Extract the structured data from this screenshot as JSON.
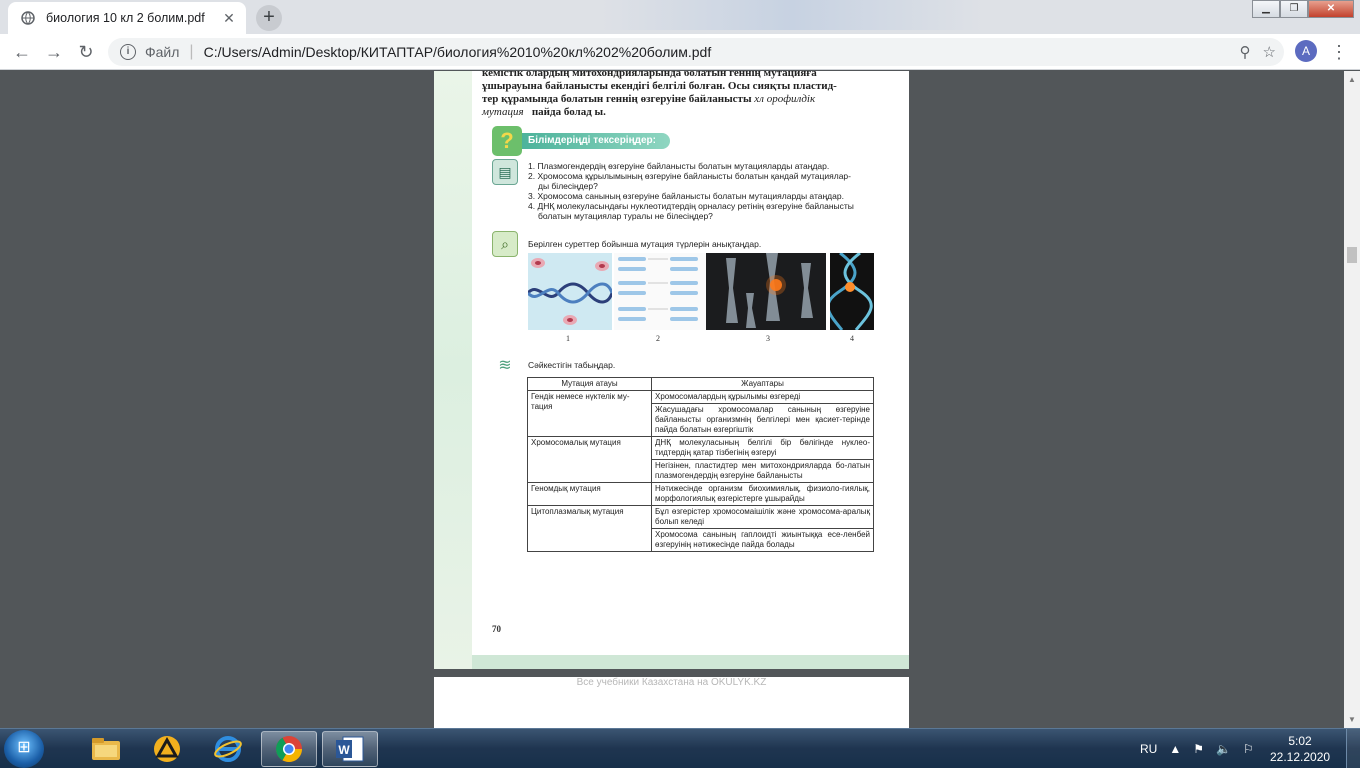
{
  "browser": {
    "tab_title": "биология 10 кл 2 болим.pdf",
    "close_glyph": "✕",
    "new_tab_glyph": "+",
    "omnibox_label": "Файл",
    "url": "C:/Users/Admin/Desktop/КИТАПТАР/биология%2010%20кл%202%20болим.pdf",
    "profile_initial": "A"
  },
  "page": {
    "intro_line1": "кемістік олардың митохондрияларында болатын геннің мутацияға",
    "intro_line2": "ұшырауына байланысты екендігі белгілі болған. Осы сияқты пластид-",
    "intro_line3": "тер құрамында болатын геннің өзгеруіне байланысты",
    "intro_italic": "хл орофилдік",
    "intro_italic2": "мутация",
    "intro_end": "пайда болад ы.",
    "check_title": "Білімдеріңді тексеріңдер:",
    "questions": [
      "1. Плазмогендердің өзгеруіне байланысты болатын мутацияларды атаңдар.",
      "2. Хромосома құрылымының өзгеруіне байланысты болатын қандай мутациялар-",
      "ды білесіңдер?",
      "3. Хромосома санының өзгеруіне байланысты болатын мутацияларды атаңдар.",
      "4. ДНҚ молекуласындағы нуклеотидтердің орналасу ретінің өзгеруіне байланысты",
      "болатын мутациялар туралы не білесіңдер?"
    ],
    "images_caption": "Берілген суреттер бойынша мутация түрлерін анықтаңдар.",
    "image_numbers": [
      "1",
      "2",
      "3",
      "4"
    ],
    "match_caption": "Сәйкестігін табыңдар.",
    "table_headers": [
      "Мутация атауы",
      "Жауаптары"
    ],
    "table_rows": [
      {
        "name": "Гендік немесе нүктелік му-тация",
        "answers": [
          "Хромосомалардың құрылымы өзгереді",
          "Жасушадағы хромосомалар санының өзгеруіне байланысты организмнің белгілері мен қасиет-терінде пайда болатын өзгергіштік"
        ]
      },
      {
        "name": "Хромосомалық мутация",
        "answers": [
          "ДНҚ молекуласының белгілі бір бөлігінде нуклео-тидтердің қатар тізбегінің өзгеруі",
          "Негізінен, пластидтер мен митохондрияларда бо-латын плазмогендердің өзгеруіне байланысты"
        ]
      },
      {
        "name": "Геномдық мутация",
        "answers": [
          "Нәтижесінде организм биохимиялық, физиоло-гиялық, морфологиялық өзгерістерге ұшырайды"
        ]
      },
      {
        "name": "Цитоплазмалық мутация",
        "answers": [
          "Бұл өзгерістер хромосомаішілік және хромосома-аралық болып келеді",
          "Хромосома санының гаплоидті жиынтыққа есе-ленбей өзгеруінің нәтижесінде пайда болады"
        ]
      }
    ],
    "page_number": "70",
    "footer_watermark": "Все учебники Казахстана на OKULYK.KZ"
  },
  "taskbar": {
    "lang": "RU",
    "time": "5:02",
    "date": "22.12.2020"
  },
  "colors": {
    "accent_teal": "#4db39b",
    "viewer_bg": "#525659",
    "tab_bar": "#dee1e6"
  }
}
